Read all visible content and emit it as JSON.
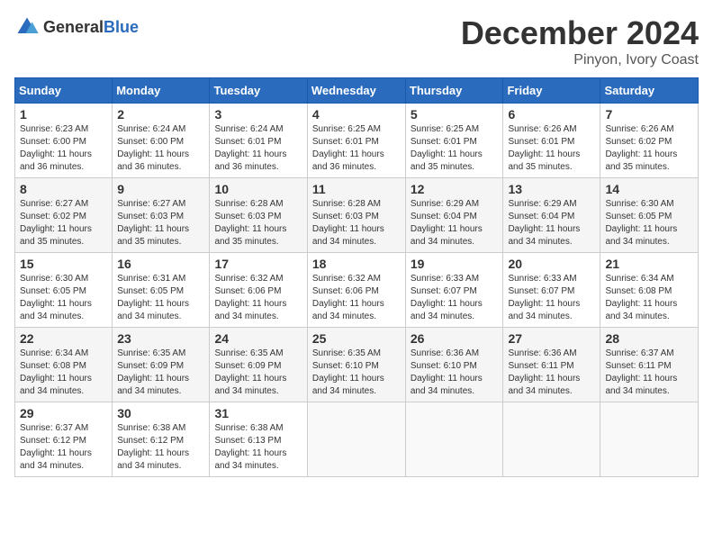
{
  "logo": {
    "general": "General",
    "blue": "Blue"
  },
  "title": "December 2024",
  "location": "Pinyon, Ivory Coast",
  "days_of_week": [
    "Sunday",
    "Monday",
    "Tuesday",
    "Wednesday",
    "Thursday",
    "Friday",
    "Saturday"
  ],
  "weeks": [
    [
      {
        "day": "1",
        "sunrise": "6:23 AM",
        "sunset": "6:00 PM",
        "daylight": "11 hours and 36 minutes."
      },
      {
        "day": "2",
        "sunrise": "6:24 AM",
        "sunset": "6:00 PM",
        "daylight": "11 hours and 36 minutes."
      },
      {
        "day": "3",
        "sunrise": "6:24 AM",
        "sunset": "6:01 PM",
        "daylight": "11 hours and 36 minutes."
      },
      {
        "day": "4",
        "sunrise": "6:25 AM",
        "sunset": "6:01 PM",
        "daylight": "11 hours and 36 minutes."
      },
      {
        "day": "5",
        "sunrise": "6:25 AM",
        "sunset": "6:01 PM",
        "daylight": "11 hours and 35 minutes."
      },
      {
        "day": "6",
        "sunrise": "6:26 AM",
        "sunset": "6:01 PM",
        "daylight": "11 hours and 35 minutes."
      },
      {
        "day": "7",
        "sunrise": "6:26 AM",
        "sunset": "6:02 PM",
        "daylight": "11 hours and 35 minutes."
      }
    ],
    [
      {
        "day": "8",
        "sunrise": "6:27 AM",
        "sunset": "6:02 PM",
        "daylight": "11 hours and 35 minutes."
      },
      {
        "day": "9",
        "sunrise": "6:27 AM",
        "sunset": "6:03 PM",
        "daylight": "11 hours and 35 minutes."
      },
      {
        "day": "10",
        "sunrise": "6:28 AM",
        "sunset": "6:03 PM",
        "daylight": "11 hours and 35 minutes."
      },
      {
        "day": "11",
        "sunrise": "6:28 AM",
        "sunset": "6:03 PM",
        "daylight": "11 hours and 34 minutes."
      },
      {
        "day": "12",
        "sunrise": "6:29 AM",
        "sunset": "6:04 PM",
        "daylight": "11 hours and 34 minutes."
      },
      {
        "day": "13",
        "sunrise": "6:29 AM",
        "sunset": "6:04 PM",
        "daylight": "11 hours and 34 minutes."
      },
      {
        "day": "14",
        "sunrise": "6:30 AM",
        "sunset": "6:05 PM",
        "daylight": "11 hours and 34 minutes."
      }
    ],
    [
      {
        "day": "15",
        "sunrise": "6:30 AM",
        "sunset": "6:05 PM",
        "daylight": "11 hours and 34 minutes."
      },
      {
        "day": "16",
        "sunrise": "6:31 AM",
        "sunset": "6:05 PM",
        "daylight": "11 hours and 34 minutes."
      },
      {
        "day": "17",
        "sunrise": "6:32 AM",
        "sunset": "6:06 PM",
        "daylight": "11 hours and 34 minutes."
      },
      {
        "day": "18",
        "sunrise": "6:32 AM",
        "sunset": "6:06 PM",
        "daylight": "11 hours and 34 minutes."
      },
      {
        "day": "19",
        "sunrise": "6:33 AM",
        "sunset": "6:07 PM",
        "daylight": "11 hours and 34 minutes."
      },
      {
        "day": "20",
        "sunrise": "6:33 AM",
        "sunset": "6:07 PM",
        "daylight": "11 hours and 34 minutes."
      },
      {
        "day": "21",
        "sunrise": "6:34 AM",
        "sunset": "6:08 PM",
        "daylight": "11 hours and 34 minutes."
      }
    ],
    [
      {
        "day": "22",
        "sunrise": "6:34 AM",
        "sunset": "6:08 PM",
        "daylight": "11 hours and 34 minutes."
      },
      {
        "day": "23",
        "sunrise": "6:35 AM",
        "sunset": "6:09 PM",
        "daylight": "11 hours and 34 minutes."
      },
      {
        "day": "24",
        "sunrise": "6:35 AM",
        "sunset": "6:09 PM",
        "daylight": "11 hours and 34 minutes."
      },
      {
        "day": "25",
        "sunrise": "6:35 AM",
        "sunset": "6:10 PM",
        "daylight": "11 hours and 34 minutes."
      },
      {
        "day": "26",
        "sunrise": "6:36 AM",
        "sunset": "6:10 PM",
        "daylight": "11 hours and 34 minutes."
      },
      {
        "day": "27",
        "sunrise": "6:36 AM",
        "sunset": "6:11 PM",
        "daylight": "11 hours and 34 minutes."
      },
      {
        "day": "28",
        "sunrise": "6:37 AM",
        "sunset": "6:11 PM",
        "daylight": "11 hours and 34 minutes."
      }
    ],
    [
      {
        "day": "29",
        "sunrise": "6:37 AM",
        "sunset": "6:12 PM",
        "daylight": "11 hours and 34 minutes."
      },
      {
        "day": "30",
        "sunrise": "6:38 AM",
        "sunset": "6:12 PM",
        "daylight": "11 hours and 34 minutes."
      },
      {
        "day": "31",
        "sunrise": "6:38 AM",
        "sunset": "6:13 PM",
        "daylight": "11 hours and 34 minutes."
      },
      null,
      null,
      null,
      null
    ]
  ]
}
